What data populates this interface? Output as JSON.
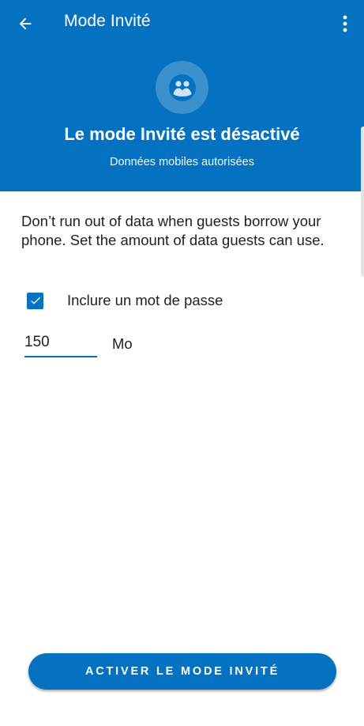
{
  "header": {
    "title": "Mode Invité",
    "status_title": "Le mode Invité est désactivé",
    "status_subtitle": "Données mobiles autorisées",
    "back_icon": "arrow-left-icon",
    "menu_icon": "more-vert-icon",
    "hero_icon": "guest-mode-icon"
  },
  "content": {
    "description": "Don’t run out of data when guests borrow your phone. Set the amount of data guests can use.",
    "password_checkbox": {
      "label": "Inclure un mot de passe",
      "checked": true
    },
    "data_limit": {
      "value": "150",
      "unit": "Mo"
    }
  },
  "footer": {
    "activate_label": "ACTIVER LE MODE INVITÉ"
  },
  "colors": {
    "accent": "#0572c1",
    "text": "#202124",
    "background": "#ffffff"
  }
}
